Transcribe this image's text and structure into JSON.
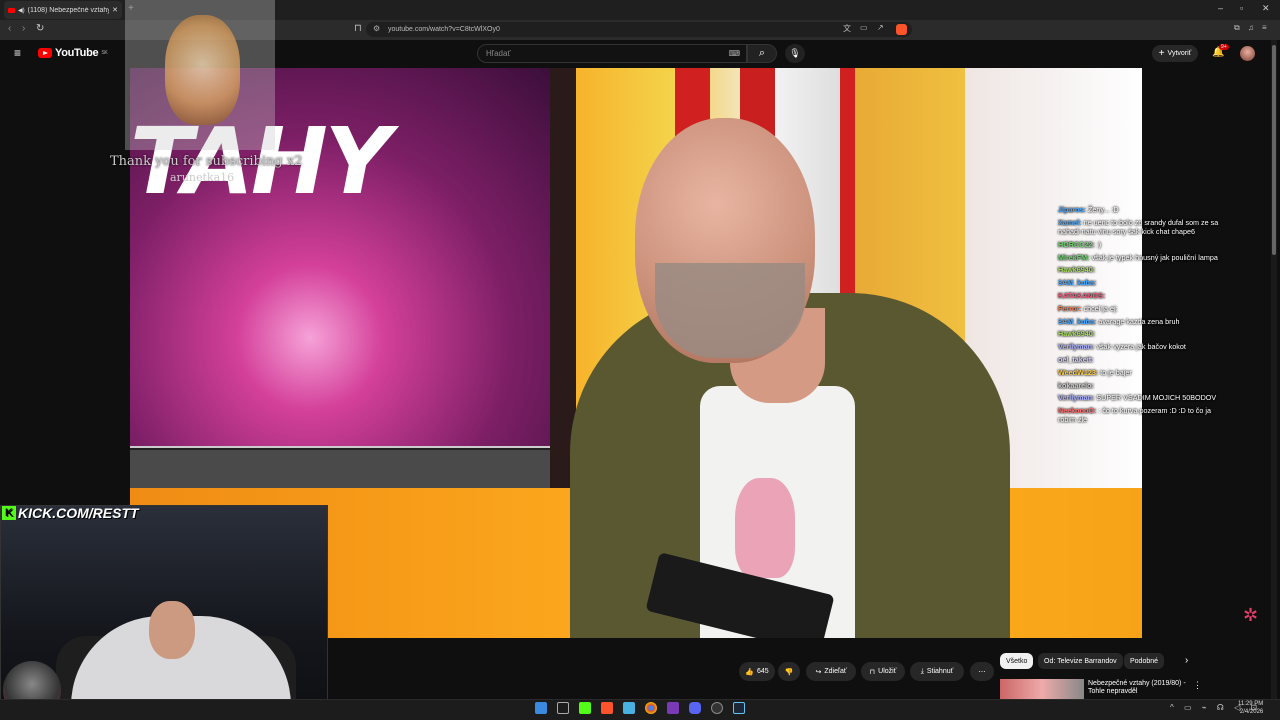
{
  "browser": {
    "tab_title": "(1108) Nebezpečné vztahy (2",
    "url": "youtube.com/watch?v=C8tcWlXOy0"
  },
  "youtube": {
    "logo_text": "YouTube",
    "region": "SK",
    "search_placeholder": "Hľadať",
    "create_label": "Vytvoriť",
    "notif_count": "9+"
  },
  "video": {
    "title_text": "TAHY"
  },
  "overlay": {
    "kick_text": "KICK.COM/RESTT",
    "sub_notice": "Thank you for subscribing x2",
    "sub_user": "arunetka16"
  },
  "chat": [
    {
      "user": "Jiparos:",
      "text": "Ženy... :D",
      "color": "#4aa8ff"
    },
    {
      "user": "Xamel:",
      "text": "ne uenc to bolo zo srandy dufal som ze sa nahadi natu vinu sory šak kick chat chape6",
      "color": "#4aa8ff"
    },
    {
      "user": "HORCC22:",
      "text": ":)",
      "color": "#6fd86f"
    },
    {
      "user": "MirekFM:",
      "text": "však je typek hnusný jak pouliční lampa",
      "color": "#6fd86f"
    },
    {
      "user": "Hawk6940:",
      "text": "",
      "color": "#a8e060"
    },
    {
      "user": "3AM_kuba:",
      "text": "",
      "color": "#4aa8ff"
    },
    {
      "user": "KATAKANOS:",
      "text": "",
      "color": "#ff5577"
    },
    {
      "user": "Ferror:",
      "text": "chcel ja ej:",
      "color": "#ff7744"
    },
    {
      "user": "3AM_kuba:",
      "text": "avarage kazda zena bruh",
      "color": "#4aa8ff"
    },
    {
      "user": "Hawk6940:",
      "text": "",
      "color": "#a8e060"
    },
    {
      "user": "Verilyman:",
      "text": "však vyzera jak bačov kokot",
      "color": "#aab0ff"
    },
    {
      "user": "oel_takeit:",
      "text": "",
      "color": "#d0d0ff"
    },
    {
      "user": "WeedW123:",
      "text": "to je bajer",
      "color": "#ffcc44"
    },
    {
      "user": "kokaarelo:",
      "text": "",
      "color": "#cccccc"
    },
    {
      "user": "Verilyman:",
      "text": "SUPER VSADIM MOJICH 50BODOV",
      "color": "#aab0ff"
    },
    {
      "user": "NeekoooO:",
      "text": ": čo to kurva pozeram :D :D to čo ja robim zle",
      "color": "#ff6f6f"
    }
  ],
  "actions": {
    "like_count": "645",
    "share_label": "Zdieľať",
    "save_label": "Uložiť",
    "download_label": "Stiahnuť",
    "more_label": "⋯"
  },
  "chips": [
    "Všetko",
    "Od: Televize Barrandov",
    "Podobné"
  ],
  "related": {
    "title": "Nebezpečné vztahy (2019/80) - Tohle nepravděl"
  },
  "taskbar": {
    "time": "11:29 PM",
    "date": "2/4/2026"
  }
}
